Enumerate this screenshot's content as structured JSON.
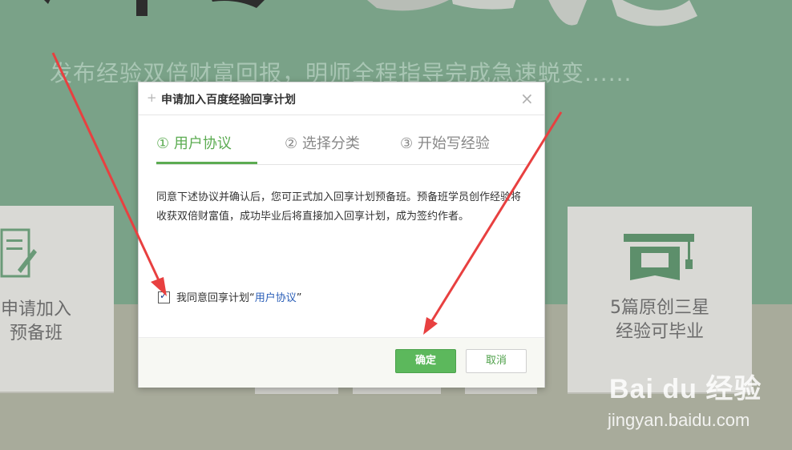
{
  "background": {
    "slogan": "发布经验双倍财富回报，明师全程指导完成急速蜕变......",
    "left_card_text": [
      "申请加入",
      "预备班"
    ],
    "right_card_text": [
      "5篇原创三星",
      "经验可毕业"
    ]
  },
  "dialog": {
    "title": "申请加入百度经验回享计划",
    "close": "×",
    "plus": "+",
    "steps": [
      {
        "label": "① 用户协议",
        "active": true
      },
      {
        "label": "② 选择分类",
        "active": false
      },
      {
        "label": "③ 开始写经验",
        "active": false
      }
    ],
    "body_text": "同意下述协议并确认后，您可正式加入回享计划预备班。预备班学员创作经验将收获双倍财富值，成功毕业后将直接加入回享计划，成为签约作者。",
    "agree_prefix": "我同意回享计划“",
    "agree_link": "用户协议",
    "agree_suffix": "”",
    "agree_checked": true,
    "ok_button": "确定",
    "cancel_button": "取消"
  },
  "watermark": {
    "logo": "Bai du 经验",
    "url": "jingyan.baidu.com"
  },
  "colors": {
    "accent_green": "#5cac52",
    "arrow_red": "#e84040",
    "link_blue": "#2b5fb8"
  }
}
